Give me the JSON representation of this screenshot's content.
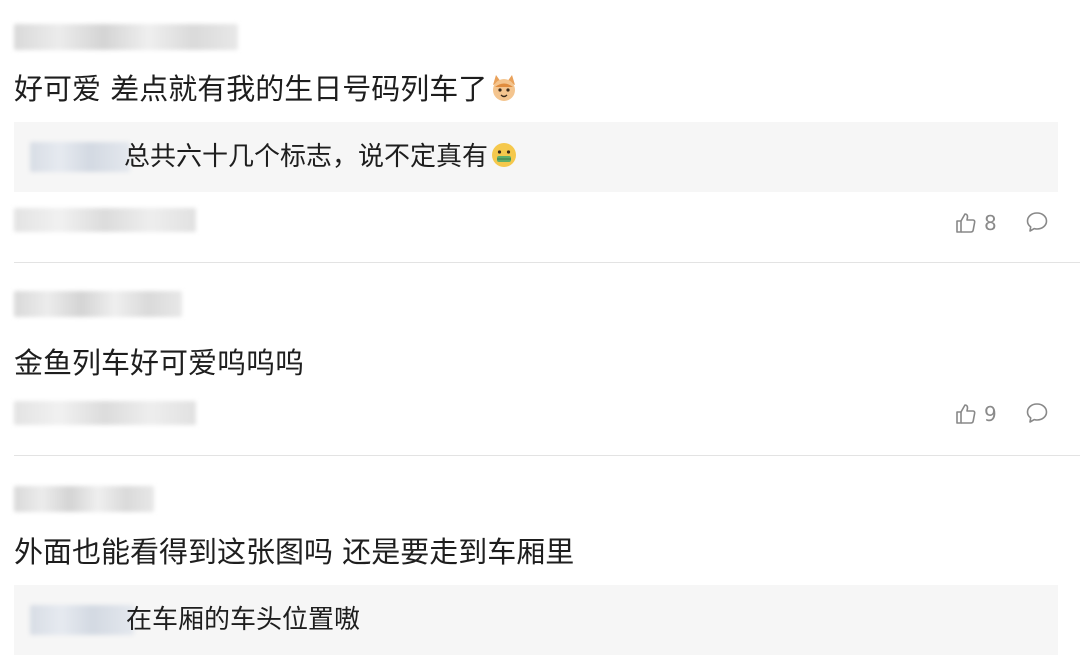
{
  "comments": [
    {
      "text": "好可爱 差点就有我的生日号码列车了",
      "emoji": "cat-face-emoji",
      "reply": {
        "text": "总共六十几个标志，说不定真有",
        "emoji": "grimacing-face-emoji"
      },
      "likes": "8"
    },
    {
      "text": "金鱼列车好可爱呜呜呜",
      "likes": "9"
    },
    {
      "text": "外面也能看得到这张图吗 还是要走到车厢里",
      "reply": {
        "text": "在车厢的车头位置嗷"
      }
    }
  ],
  "icons": {
    "like": "thumbs-up-icon",
    "comment": "comment-bubble-icon"
  },
  "colors": {
    "reply_background": "#f6f6f6",
    "meta_text": "#8a8a8a",
    "divider": "#e3e3e3"
  }
}
